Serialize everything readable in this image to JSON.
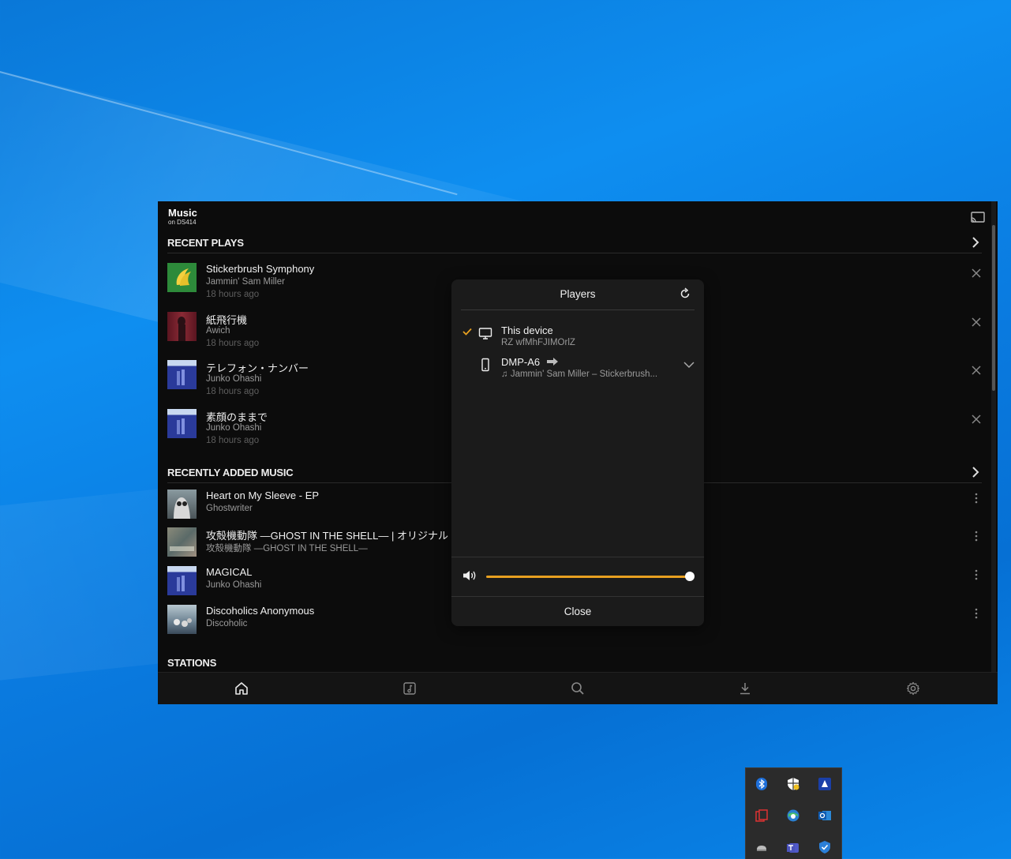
{
  "app": {
    "title": "Music",
    "subtitle": "on DS414",
    "sections": {
      "recent_plays": {
        "title": "RECENT PLAYS"
      },
      "recently_added": {
        "title": "RECENTLY ADDED MUSIC"
      },
      "stations": {
        "title": "STATIONS"
      }
    },
    "recent_plays": [
      {
        "title": "Stickerbrush Symphony",
        "artist": "Jammin' Sam Miller",
        "time": "18 hours ago"
      },
      {
        "title": "紙飛行機",
        "artist": "Awich",
        "time": "18 hours ago"
      },
      {
        "title": "テレフォン・ナンバー",
        "artist": "Junko Ohashi",
        "time": "18 hours ago"
      },
      {
        "title": "素顔のままで",
        "artist": "Junko Ohashi",
        "time": "18 hours ago"
      }
    ],
    "recently_added": [
      {
        "title": "Heart on My Sleeve - EP",
        "artist": "Ghostwriter"
      },
      {
        "title": "攻殻機動隊 ―GHOST IN THE SHELL― | オリジナル",
        "artist": "攻殻機動隊 ―GHOST IN THE SHELL―"
      },
      {
        "title": "MAGICAL",
        "artist": "Junko Ohashi"
      },
      {
        "title": "Discoholics Anonymous",
        "artist": "Discoholic"
      }
    ],
    "nav": [
      "home-icon",
      "music-note-icon",
      "search-icon",
      "download-icon",
      "settings-icon"
    ]
  },
  "players": {
    "title": "Players",
    "devices": [
      {
        "name": "This device",
        "sub": "RZ wfMhFJIMOrlZ",
        "selected": true,
        "icon": "monitor-icon"
      },
      {
        "name": "DMP-A6",
        "sub": "♫ Jammin' Sam Miller – Stickerbrush...",
        "selected": false,
        "icon": "phone-icon"
      }
    ],
    "volume": 1.0,
    "close_label": "Close"
  },
  "colors": {
    "accent": "#e8a020",
    "app_bg": "#0c0c0c",
    "dialog_bg": "#1b1b1b"
  },
  "tray_icons": [
    "bluetooth-icon",
    "security-shield-icon",
    "vpn-icon",
    "app-switch-icon",
    "browser-icon",
    "outlook-icon",
    "network-drive-icon",
    "teams-icon",
    "defender-icon"
  ]
}
